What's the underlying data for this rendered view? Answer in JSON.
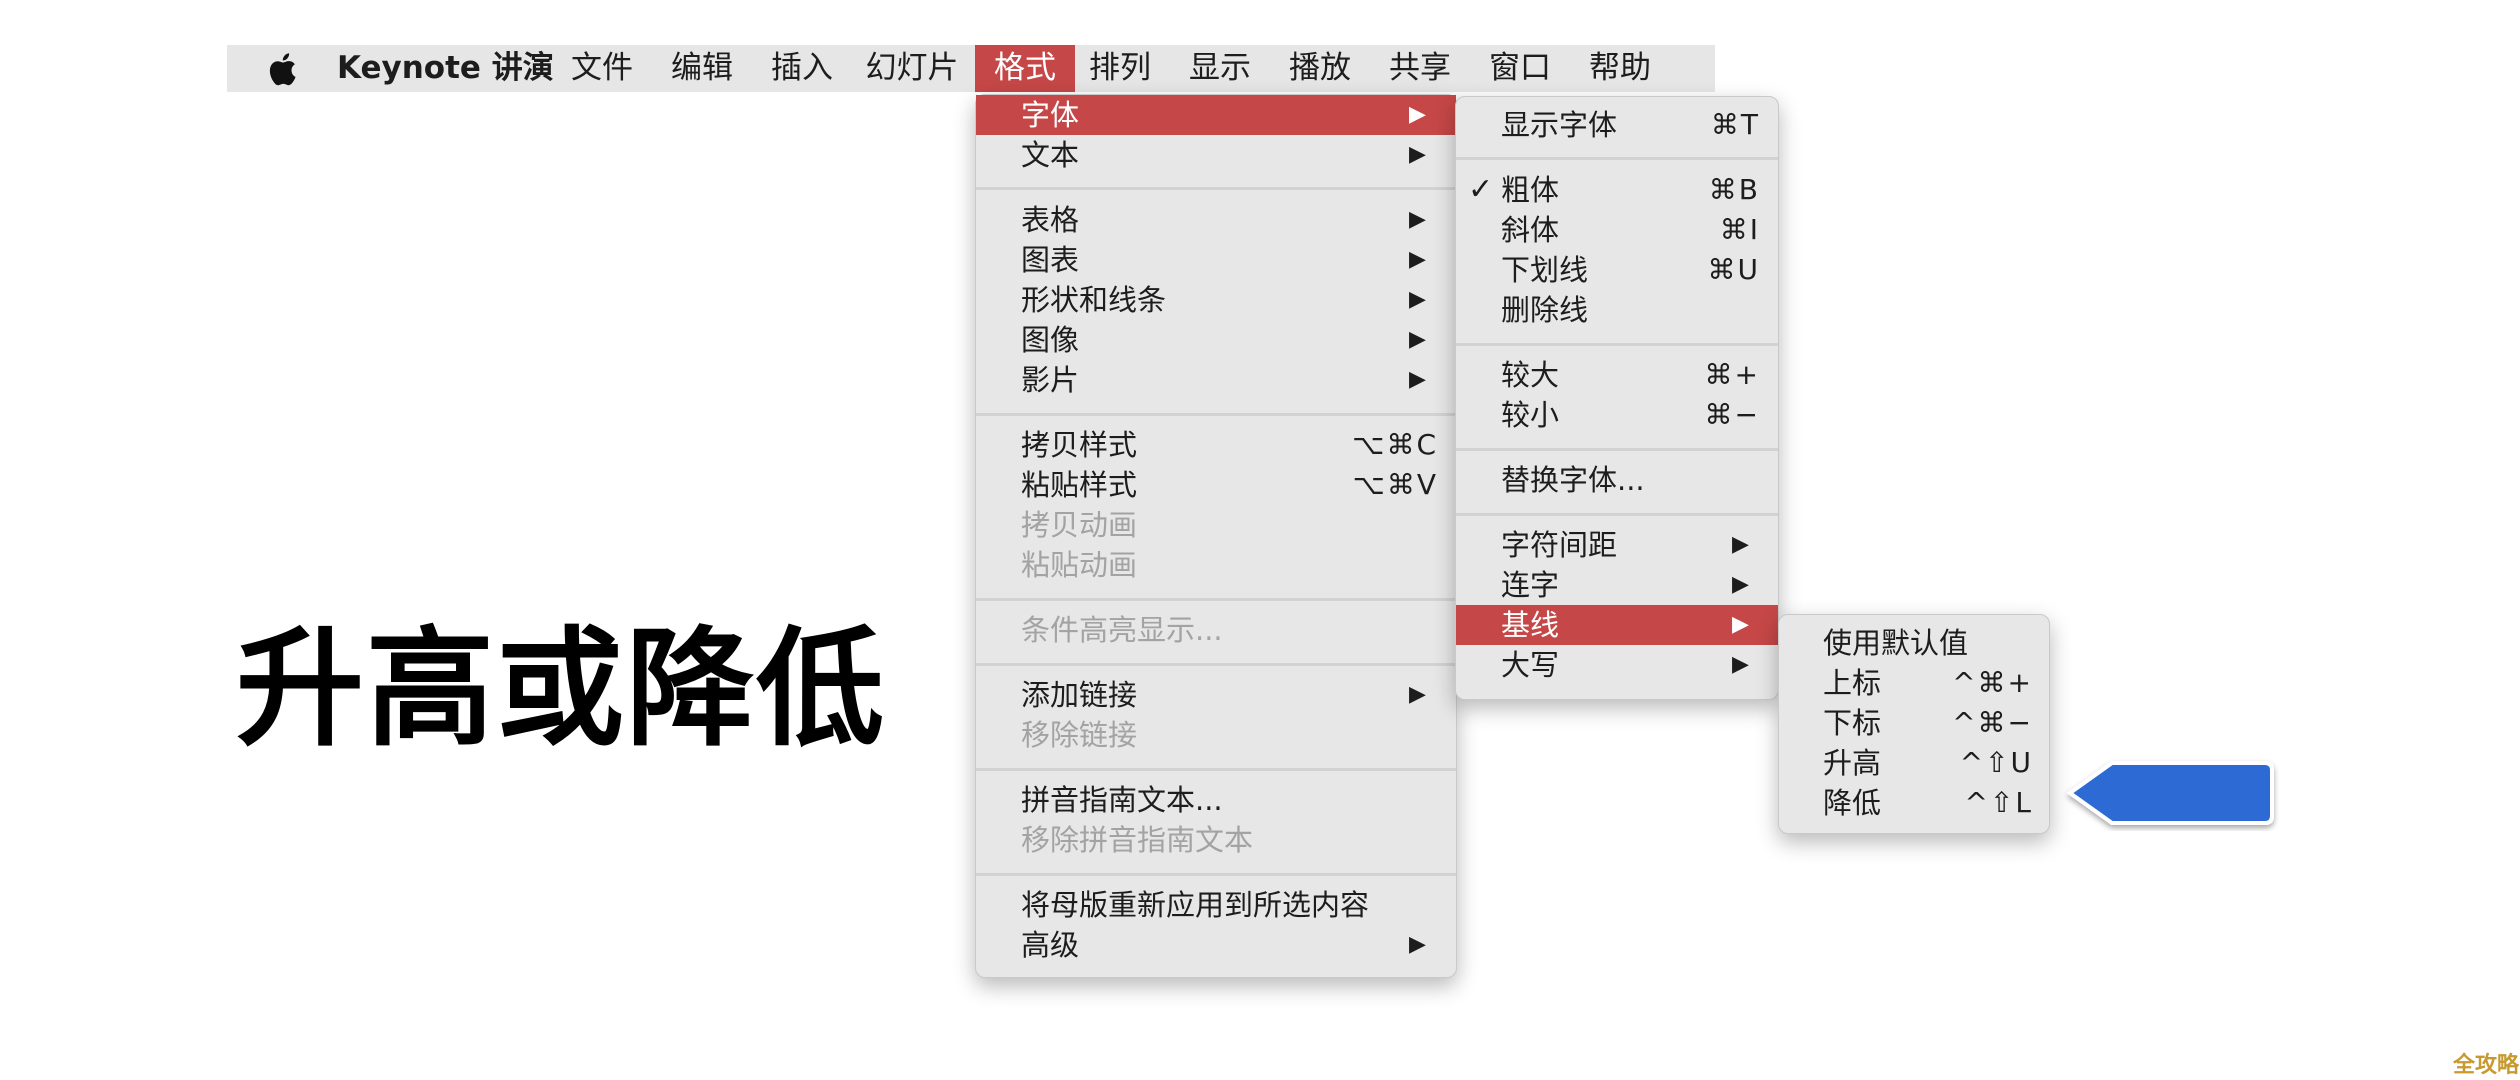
{
  "menubar": {
    "apple_icon": "apple-logo-icon",
    "items": [
      "Keynote 讲演",
      "文件",
      "编辑",
      "插入",
      "幻灯片",
      "格式",
      "排列",
      "显示",
      "播放",
      "共享",
      "窗口",
      "帮助"
    ],
    "active": "格式"
  },
  "format_menu": {
    "items": [
      {
        "label": "字体",
        "submenu": true,
        "highlighted": true
      },
      {
        "label": "文本",
        "submenu": true
      },
      {
        "label": "表格",
        "submenu": true
      },
      {
        "label": "图表",
        "submenu": true
      },
      {
        "label": "形状和线条",
        "submenu": true
      },
      {
        "label": "图像",
        "submenu": true
      },
      {
        "label": "影片",
        "submenu": true
      },
      {
        "label": "拷贝样式",
        "shortcut": "⌥⌘C"
      },
      {
        "label": "粘贴样式",
        "shortcut": "⌥⌘V"
      },
      {
        "label": "拷贝动画",
        "disabled": true
      },
      {
        "label": "粘贴动画",
        "disabled": true
      },
      {
        "label": "条件高亮显示...",
        "disabled": true
      },
      {
        "label": "添加链接",
        "submenu": true
      },
      {
        "label": "移除链接",
        "disabled": true
      },
      {
        "label": "拼音指南文本..."
      },
      {
        "label": "移除拼音指南文本",
        "disabled": true
      },
      {
        "label": "将母版重新应用到所选内容"
      },
      {
        "label": "高级",
        "submenu": true
      }
    ]
  },
  "font_menu": {
    "items": [
      {
        "label": "显示字体",
        "shortcut": "⌘T"
      },
      {
        "label": "粗体",
        "shortcut": "⌘B",
        "checked": true
      },
      {
        "label": "斜体",
        "shortcut": "⌘I"
      },
      {
        "label": "下划线",
        "shortcut": "⌘U"
      },
      {
        "label": "删除线"
      },
      {
        "label": "较大",
        "shortcut": "⌘+"
      },
      {
        "label": "较小",
        "shortcut": "⌘−"
      },
      {
        "label": "替换字体..."
      },
      {
        "label": "字符间距",
        "submenu": true
      },
      {
        "label": "连字",
        "submenu": true
      },
      {
        "label": "基线",
        "submenu": true,
        "highlighted": true
      },
      {
        "label": "大写",
        "submenu": true
      }
    ]
  },
  "baseline_menu": {
    "items": [
      {
        "label": "使用默认值"
      },
      {
        "label": "上标",
        "shortcut": "^⌘+"
      },
      {
        "label": "下标",
        "shortcut": "^⌘−"
      },
      {
        "label": "升高",
        "shortcut": "^⇧U"
      },
      {
        "label": "降低",
        "shortcut": "^⇧L"
      }
    ]
  },
  "symbols": {
    "arrow": "▶",
    "check": "✓"
  },
  "stage": {
    "text": "升高或降低"
  },
  "watermark": "全攻略",
  "colors": {
    "highlight": "#c64747",
    "menu_bg": "#e7e7e7",
    "pointer": "#2f6bd3"
  }
}
